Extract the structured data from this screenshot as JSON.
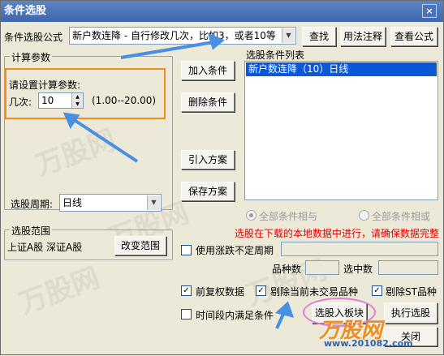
{
  "window": {
    "title": "条件选股",
    "close_glyph": "×"
  },
  "formula": {
    "label": "条件选股公式",
    "value": "新户数连降  -  自行修改几次，比如3，或者10等",
    "buttons": {
      "find": "查找",
      "usage": "用法注释",
      "view": "查看公式"
    }
  },
  "params": {
    "legend": "计算参数",
    "prompt": "请设置计算参数:",
    "times_label": "几次:",
    "times_value": "10",
    "range_text": "(1.00--20.00)"
  },
  "actions": {
    "add": "加入条件",
    "delete": "删除条件",
    "import": "引入方案",
    "save": "保存方案"
  },
  "condition_list": {
    "label": "选股条件列表",
    "items": [
      "新户数连降（10）日线"
    ]
  },
  "period": {
    "label": "选股周期:",
    "value": "日线"
  },
  "logic": {
    "and_label": "全部条件相与",
    "or_label": "全部条件相或"
  },
  "notice": "选股在下载的本地数据中进行，请确保数据完整",
  "scope": {
    "legend": "选股范围",
    "markets": "上证A股  深证A股",
    "change_button": "改变范围"
  },
  "options": {
    "variable_period": "使用涨跌不定周期",
    "forward_adjust": "前复权数据",
    "exclude_untraded": "剔除当前未交易品种",
    "exclude_st": "剔除ST品种",
    "time_range": "时间段内满足条件"
  },
  "stats": {
    "count_label": "品种数",
    "selected_label": "选中数"
  },
  "bottom_buttons": {
    "to_block": "选股入板块",
    "execute": "执行选股",
    "close": "关闭"
  },
  "watermark": {
    "brand": "万股网",
    "site": "www.201082.com"
  },
  "colors": {
    "highlight": "#0a57d8",
    "annotation": "#f28c1b",
    "arrow": "#4a90e2"
  }
}
